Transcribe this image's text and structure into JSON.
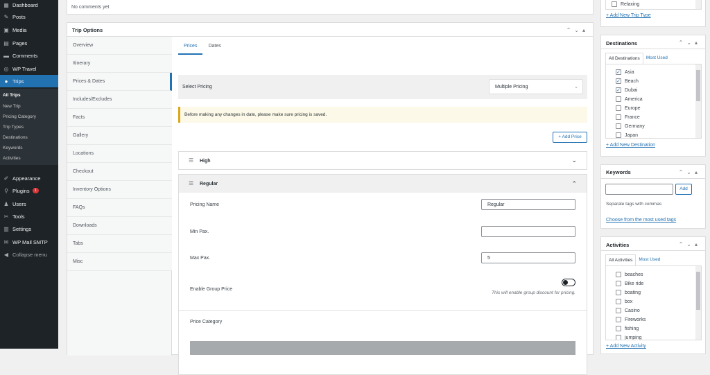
{
  "admin_menu": {
    "top_item": "Dashboard",
    "items": [
      {
        "label": "Posts",
        "icon": "pin-icon"
      },
      {
        "label": "Media",
        "icon": "media-icon"
      },
      {
        "label": "Pages",
        "icon": "pages-icon"
      },
      {
        "label": "Comments",
        "icon": "comment-icon"
      },
      {
        "label": "WP Travel",
        "icon": "compass-icon"
      },
      {
        "label": "Trips",
        "icon": "location-icon"
      }
    ],
    "trips_sub": [
      "All Trips",
      "New Trip",
      "Pricing Category",
      "Trip Types",
      "Destinations",
      "Keywords",
      "Activities"
    ],
    "lower": [
      {
        "label": "Appearance"
      },
      {
        "label": "Plugins",
        "badge": "1"
      },
      {
        "label": "Users"
      },
      {
        "label": "Tools"
      },
      {
        "label": "Settings"
      },
      {
        "label": "WP Mail SMTP"
      },
      {
        "label": "Collapse menu"
      }
    ]
  },
  "comments": {
    "text": "No comments yet"
  },
  "trip_options": {
    "title": "Trip Options",
    "tabs": [
      "Overview",
      "Itinerary",
      "Prices & Dates",
      "Includes/Excludes",
      "Facts",
      "Gallery",
      "Locations",
      "Checkout",
      "Inventory Options",
      "FAQs",
      "Downloads",
      "Tabs",
      "Misc"
    ],
    "subtabs": [
      "Prices",
      "Dates"
    ],
    "select_pricing_label": "Select Pricing",
    "select_pricing_value": "Multiple Pricing",
    "notice": "Before making any changes in date, please make sure pricing is saved.",
    "add_price": "+ Add Price",
    "prices": [
      {
        "name": "High"
      },
      {
        "name": "Regular"
      }
    ],
    "form": {
      "pricing_name_label": "Pricing Name",
      "pricing_name_value": "Regular",
      "min_pax_label": "Min Pax.",
      "min_pax_value": "",
      "max_pax_label": "Max Pax.",
      "max_pax_value": "5",
      "group_price_label": "Enable Group Price",
      "group_price_hint": "This will enable group discount for pricing.",
      "group_price_enabled": false,
      "price_category_label": "Price Category"
    }
  },
  "trip_types": {
    "last_item": "Relaxing",
    "add_link": "+ Add New Trip Type"
  },
  "destinations": {
    "title": "Destinations",
    "tabs": [
      "All Destinations",
      "Most Used"
    ],
    "items": [
      {
        "label": "Asia",
        "checked": true
      },
      {
        "label": "Beach",
        "checked": true
      },
      {
        "label": "Dubai",
        "checked": true
      },
      {
        "label": "America",
        "checked": false
      },
      {
        "label": "Europe",
        "checked": false
      },
      {
        "label": "France",
        "checked": false
      },
      {
        "label": "Germany",
        "checked": false
      },
      {
        "label": "Japan",
        "checked": false
      }
    ],
    "add_link": "+ Add New Destination"
  },
  "keywords": {
    "title": "Keywords",
    "add": "Add",
    "hint": "Separate tags with commas",
    "choose": "Choose from the most used tags"
  },
  "activities": {
    "title": "Activities",
    "tabs": [
      "All Activities",
      "Most Used"
    ],
    "items": [
      "beaches",
      "Bike ride",
      "boating",
      "box",
      "Casino",
      "Fireworks",
      "fishing",
      "jumping"
    ],
    "add_link": "+ Add New Activity"
  },
  "colors": {
    "accent": "#2271b1",
    "sidebar": "#1d2327"
  }
}
